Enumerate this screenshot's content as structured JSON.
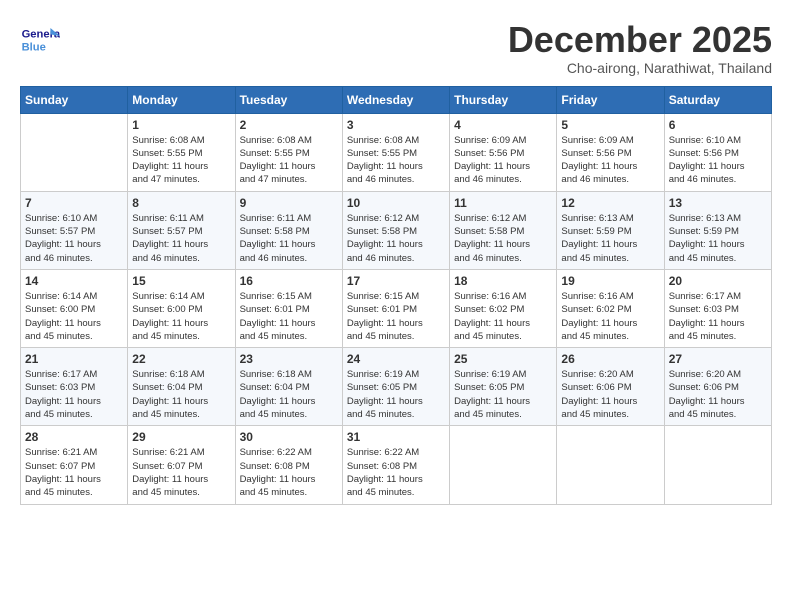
{
  "header": {
    "logo_text_general": "General",
    "logo_text_blue": "Blue",
    "month_title": "December 2025",
    "subtitle": "Cho-airong, Narathiwat, Thailand"
  },
  "weekdays": [
    "Sunday",
    "Monday",
    "Tuesday",
    "Wednesday",
    "Thursday",
    "Friday",
    "Saturday"
  ],
  "weeks": [
    [
      {
        "day": "",
        "info": ""
      },
      {
        "day": "1",
        "info": "Sunrise: 6:08 AM\nSunset: 5:55 PM\nDaylight: 11 hours\nand 47 minutes."
      },
      {
        "day": "2",
        "info": "Sunrise: 6:08 AM\nSunset: 5:55 PM\nDaylight: 11 hours\nand 47 minutes."
      },
      {
        "day": "3",
        "info": "Sunrise: 6:08 AM\nSunset: 5:55 PM\nDaylight: 11 hours\nand 46 minutes."
      },
      {
        "day": "4",
        "info": "Sunrise: 6:09 AM\nSunset: 5:56 PM\nDaylight: 11 hours\nand 46 minutes."
      },
      {
        "day": "5",
        "info": "Sunrise: 6:09 AM\nSunset: 5:56 PM\nDaylight: 11 hours\nand 46 minutes."
      },
      {
        "day": "6",
        "info": "Sunrise: 6:10 AM\nSunset: 5:56 PM\nDaylight: 11 hours\nand 46 minutes."
      }
    ],
    [
      {
        "day": "7",
        "info": "Sunrise: 6:10 AM\nSunset: 5:57 PM\nDaylight: 11 hours\nand 46 minutes."
      },
      {
        "day": "8",
        "info": "Sunrise: 6:11 AM\nSunset: 5:57 PM\nDaylight: 11 hours\nand 46 minutes."
      },
      {
        "day": "9",
        "info": "Sunrise: 6:11 AM\nSunset: 5:58 PM\nDaylight: 11 hours\nand 46 minutes."
      },
      {
        "day": "10",
        "info": "Sunrise: 6:12 AM\nSunset: 5:58 PM\nDaylight: 11 hours\nand 46 minutes."
      },
      {
        "day": "11",
        "info": "Sunrise: 6:12 AM\nSunset: 5:58 PM\nDaylight: 11 hours\nand 46 minutes."
      },
      {
        "day": "12",
        "info": "Sunrise: 6:13 AM\nSunset: 5:59 PM\nDaylight: 11 hours\nand 45 minutes."
      },
      {
        "day": "13",
        "info": "Sunrise: 6:13 AM\nSunset: 5:59 PM\nDaylight: 11 hours\nand 45 minutes."
      }
    ],
    [
      {
        "day": "14",
        "info": "Sunrise: 6:14 AM\nSunset: 6:00 PM\nDaylight: 11 hours\nand 45 minutes."
      },
      {
        "day": "15",
        "info": "Sunrise: 6:14 AM\nSunset: 6:00 PM\nDaylight: 11 hours\nand 45 minutes."
      },
      {
        "day": "16",
        "info": "Sunrise: 6:15 AM\nSunset: 6:01 PM\nDaylight: 11 hours\nand 45 minutes."
      },
      {
        "day": "17",
        "info": "Sunrise: 6:15 AM\nSunset: 6:01 PM\nDaylight: 11 hours\nand 45 minutes."
      },
      {
        "day": "18",
        "info": "Sunrise: 6:16 AM\nSunset: 6:02 PM\nDaylight: 11 hours\nand 45 minutes."
      },
      {
        "day": "19",
        "info": "Sunrise: 6:16 AM\nSunset: 6:02 PM\nDaylight: 11 hours\nand 45 minutes."
      },
      {
        "day": "20",
        "info": "Sunrise: 6:17 AM\nSunset: 6:03 PM\nDaylight: 11 hours\nand 45 minutes."
      }
    ],
    [
      {
        "day": "21",
        "info": "Sunrise: 6:17 AM\nSunset: 6:03 PM\nDaylight: 11 hours\nand 45 minutes."
      },
      {
        "day": "22",
        "info": "Sunrise: 6:18 AM\nSunset: 6:04 PM\nDaylight: 11 hours\nand 45 minutes."
      },
      {
        "day": "23",
        "info": "Sunrise: 6:18 AM\nSunset: 6:04 PM\nDaylight: 11 hours\nand 45 minutes."
      },
      {
        "day": "24",
        "info": "Sunrise: 6:19 AM\nSunset: 6:05 PM\nDaylight: 11 hours\nand 45 minutes."
      },
      {
        "day": "25",
        "info": "Sunrise: 6:19 AM\nSunset: 6:05 PM\nDaylight: 11 hours\nand 45 minutes."
      },
      {
        "day": "26",
        "info": "Sunrise: 6:20 AM\nSunset: 6:06 PM\nDaylight: 11 hours\nand 45 minutes."
      },
      {
        "day": "27",
        "info": "Sunrise: 6:20 AM\nSunset: 6:06 PM\nDaylight: 11 hours\nand 45 minutes."
      }
    ],
    [
      {
        "day": "28",
        "info": "Sunrise: 6:21 AM\nSunset: 6:07 PM\nDaylight: 11 hours\nand 45 minutes."
      },
      {
        "day": "29",
        "info": "Sunrise: 6:21 AM\nSunset: 6:07 PM\nDaylight: 11 hours\nand 45 minutes."
      },
      {
        "day": "30",
        "info": "Sunrise: 6:22 AM\nSunset: 6:08 PM\nDaylight: 11 hours\nand 45 minutes."
      },
      {
        "day": "31",
        "info": "Sunrise: 6:22 AM\nSunset: 6:08 PM\nDaylight: 11 hours\nand 45 minutes."
      },
      {
        "day": "",
        "info": ""
      },
      {
        "day": "",
        "info": ""
      },
      {
        "day": "",
        "info": ""
      }
    ]
  ]
}
